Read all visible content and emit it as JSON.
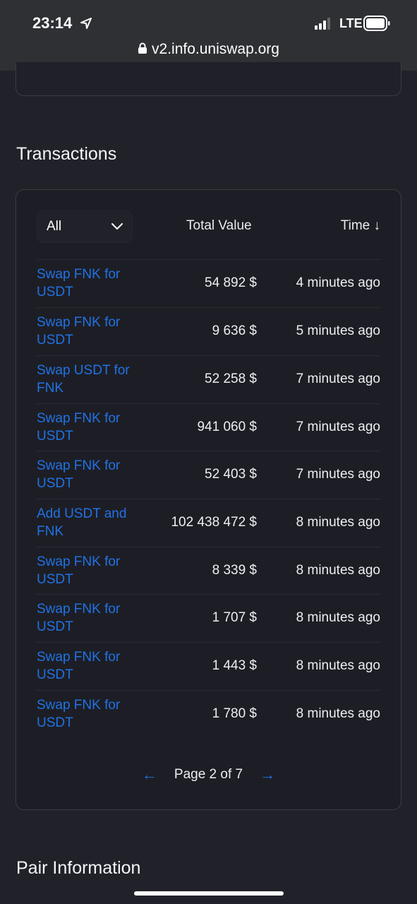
{
  "status_bar": {
    "time": "23:14",
    "network": "LTE"
  },
  "browser": {
    "url": "v2.info.uniswap.org"
  },
  "transactions": {
    "title": "Transactions",
    "filter_label": "All",
    "col_total": "Total Value",
    "col_time": "Time ↓",
    "rows": [
      {
        "action": "Swap FNK for USDT",
        "value": "54 892 $",
        "time": "4 minutes ago"
      },
      {
        "action": "Swap FNK for USDT",
        "value": "9 636 $",
        "time": "5 minutes ago"
      },
      {
        "action": "Swap USDT for FNK",
        "value": "52 258 $",
        "time": "7 minutes ago"
      },
      {
        "action": "Swap FNK for USDT",
        "value": "941 060 $",
        "time": "7 minutes ago"
      },
      {
        "action": "Swap FNK for USDT",
        "value": "52 403 $",
        "time": "7 minutes ago"
      },
      {
        "action": "Add USDT and FNK",
        "value": "102 438 472 $",
        "time": "8 minutes ago"
      },
      {
        "action": "Swap FNK for USDT",
        "value": "8 339 $",
        "time": "8 minutes ago"
      },
      {
        "action": "Swap FNK for USDT",
        "value": "1 707 $",
        "time": "8 minutes ago"
      },
      {
        "action": "Swap FNK for USDT",
        "value": "1 443 $",
        "time": "8 minutes ago"
      },
      {
        "action": "Swap FNK for USDT",
        "value": "1 780 $",
        "time": "8 minutes ago"
      }
    ],
    "pagination": {
      "prev": "←",
      "label": "Page 2 of 7",
      "next": "→"
    }
  },
  "pair_info": {
    "title": "Pair Information"
  },
  "colors": {
    "link": "#2172e5",
    "bg": "#212229",
    "card": "#1d1e25"
  }
}
